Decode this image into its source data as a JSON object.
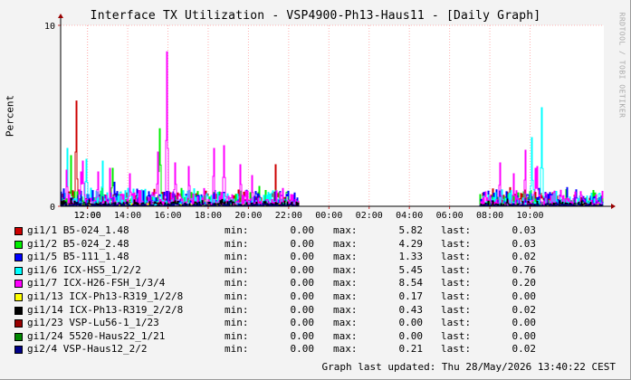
{
  "window": {
    "title": "Interface TX Utilization - VSP4900-Ph13-Haus11 - [Daily Graph]",
    "watermark": "RRDTOOL / TOBI OETIKER",
    "footer": "Graph last updated: Thu 28/May/2026 13:40:22 CEST"
  },
  "legend_labels": {
    "min": "min:",
    "max": "max:",
    "last": "last:"
  },
  "chart_data": {
    "type": "line",
    "title": "Interface TX Utilization - VSP4900-Ph13-Haus11 - [Daily Graph]",
    "xlabel": "",
    "ylabel": "Percent",
    "ylim": [
      0,
      10
    ],
    "y_ticks": [
      "0",
      "10"
    ],
    "x_ticks": [
      "12:00",
      "14:00",
      "16:00",
      "18:00",
      "20:00",
      "22:00",
      "00:00",
      "02:00",
      "04:00",
      "06:00",
      "08:00",
      "10:00",
      "12:00"
    ],
    "grid": true,
    "series": [
      {
        "name": "gi1/1 B5-024_1.48",
        "color": "#cc0000",
        "min": "0.00",
        "max": "5.82",
        "last": "0.03",
        "peaks": [
          [
            "11:25",
            5.82
          ],
          [
            "17:00",
            0.6
          ],
          [
            "19:30",
            0.9
          ],
          [
            "21:20",
            2.3
          ],
          [
            "10:10",
            0.3
          ]
        ]
      },
      {
        "name": "gi1/2 B5-024_2.48",
        "color": "#00ee00",
        "min": "0.00",
        "max": "4.29",
        "last": "0.03",
        "peaks": [
          [
            "11:10",
            2.8
          ],
          [
            "13:15",
            2.1
          ],
          [
            "15:35",
            4.29
          ],
          [
            "20:30",
            1.1
          ],
          [
            "09:40",
            0.8
          ]
        ]
      },
      {
        "name": "gi1/5 B5-111_1.48",
        "color": "#0000ff",
        "min": "0.00",
        "max": "1.33",
        "last": "0.02",
        "peaks": [
          [
            "11:30",
            0.6
          ],
          [
            "13:20",
            1.33
          ],
          [
            "16:10",
            0.5
          ],
          [
            "19:40",
            0.3
          ],
          [
            "10:00",
            0.7
          ]
        ]
      },
      {
        "name": "gi1/6 ICX-HS5_1/2/2",
        "color": "#00ffff",
        "min": "0.00",
        "max": "5.45",
        "last": "0.76",
        "peaks": [
          [
            "12:10",
            1.0
          ],
          [
            "14:30",
            0.7
          ],
          [
            "16:45",
            0.6
          ],
          [
            "08:30",
            0.5
          ],
          [
            "10:05",
            3.8
          ],
          [
            "10:35",
            5.45
          ],
          [
            "11:00",
            3.2
          ],
          [
            "11:55",
            2.6
          ],
          [
            "12:45",
            2.5
          ],
          [
            "13:35",
            0.76
          ]
        ]
      },
      {
        "name": "gi1/7 ICX-H26-FSH_1/3/4",
        "color": "#ff00ff",
        "min": "0.00",
        "max": "8.54",
        "last": "0.20",
        "peaks": [
          [
            "10:20",
            2.2
          ],
          [
            "11:45",
            2.5
          ],
          [
            "13:05",
            2.1
          ],
          [
            "14:05",
            1.8
          ],
          [
            "15:30",
            3.0
          ],
          [
            "15:55",
            8.54
          ],
          [
            "16:20",
            2.4
          ],
          [
            "17:00",
            2.2
          ],
          [
            "18:15",
            3.2
          ],
          [
            "18:45",
            3.35
          ],
          [
            "19:35",
            2.3
          ],
          [
            "20:10",
            1.7
          ],
          [
            "07:45",
            0.8
          ],
          [
            "08:30",
            2.4
          ],
          [
            "09:10",
            1.8
          ],
          [
            "09:45",
            3.1
          ],
          [
            "10:15",
            2.1
          ],
          [
            "10:55",
            2.0
          ],
          [
            "11:40",
            1.9
          ],
          [
            "12:30",
            1.9
          ],
          [
            "13:30",
            0.2
          ]
        ]
      },
      {
        "name": "gi1/13 ICX-Ph13-R319_1/2/8",
        "color": "#ffff00",
        "min": "0.00",
        "max": "0.17",
        "last": "0.00",
        "peaks": [
          [
            "12:00",
            0.17
          ],
          [
            "15:00",
            0.15
          ],
          [
            "09:00",
            0.12
          ]
        ]
      },
      {
        "name": "gi1/14 ICX-Ph13-R319_2/2/8",
        "color": "#000000",
        "min": "0.00",
        "max": "0.43",
        "last": "0.02",
        "peaks": [
          [
            "11:10",
            0.43
          ],
          [
            "14:20",
            0.35
          ],
          [
            "18:40",
            0.38
          ],
          [
            "08:50",
            0.4
          ],
          [
            "12:05",
            0.35
          ]
        ]
      },
      {
        "name": "gi1/23 VSP-Lu56-1_1/23",
        "color": "#990000",
        "min": "0.00",
        "max": "0.00",
        "last": "0.00",
        "peaks": []
      },
      {
        "name": "gi1/24 5520-Haus22_1/21",
        "color": "#008800",
        "min": "0.00",
        "max": "0.00",
        "last": "0.00",
        "peaks": []
      },
      {
        "name": "gi2/4 VSP-Haus12_2/2",
        "color": "#000088",
        "min": "0.00",
        "max": "0.21",
        "last": "0.02",
        "peaks": [
          [
            "12:40",
            0.21
          ],
          [
            "17:30",
            0.18
          ],
          [
            "11:30",
            0.2
          ]
        ]
      }
    ]
  }
}
